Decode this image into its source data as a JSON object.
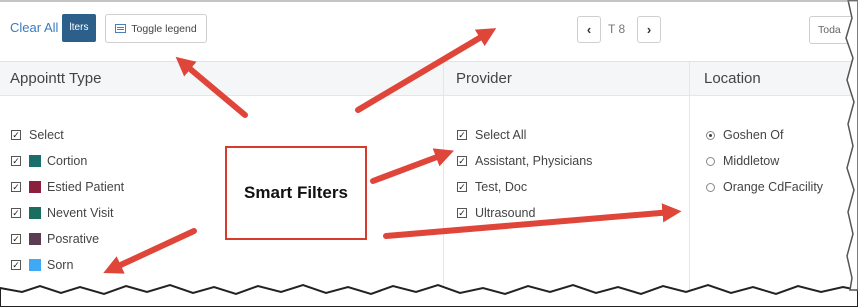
{
  "toolbar": {
    "clear_all": "Clear All",
    "filters_label": "lters",
    "toggle_legend": "Toggle legend",
    "prev_icon": "‹",
    "next_icon": "›",
    "date_text": "T 8",
    "today_label": "Toda"
  },
  "appointment_type": {
    "title": "Appointt Type",
    "options": [
      {
        "label": "Select",
        "checked": true,
        "color": null
      },
      {
        "label": "Cortion",
        "checked": true,
        "color": "#1a6e6b"
      },
      {
        "label": "Estied Patient",
        "checked": true,
        "color": "#8c1f3e"
      },
      {
        "label": "Nevent Visit",
        "checked": true,
        "color": "#1a6e5e"
      },
      {
        "label": "Posrative",
        "checked": true,
        "color": "#5a3d55"
      },
      {
        "label": "Sorn",
        "checked": true,
        "color": "#3fa9f5"
      }
    ]
  },
  "provider": {
    "title": "Provider",
    "options": [
      {
        "label": "Select All",
        "checked": true
      },
      {
        "label": "Assistant, Physicians",
        "checked": true
      },
      {
        "label": "Test, Doc",
        "checked": true
      },
      {
        "label": "Ultrasound",
        "checked": true
      }
    ]
  },
  "location": {
    "title": "Location",
    "options": [
      {
        "label": "Goshen Of",
        "selected": true
      },
      {
        "label": "Middletow",
        "selected": false
      },
      {
        "label": "Orange CdFacility",
        "selected": false
      }
    ]
  },
  "annotation": {
    "callout_text": "Smart Filters",
    "arrow_color": "#e0453a"
  }
}
